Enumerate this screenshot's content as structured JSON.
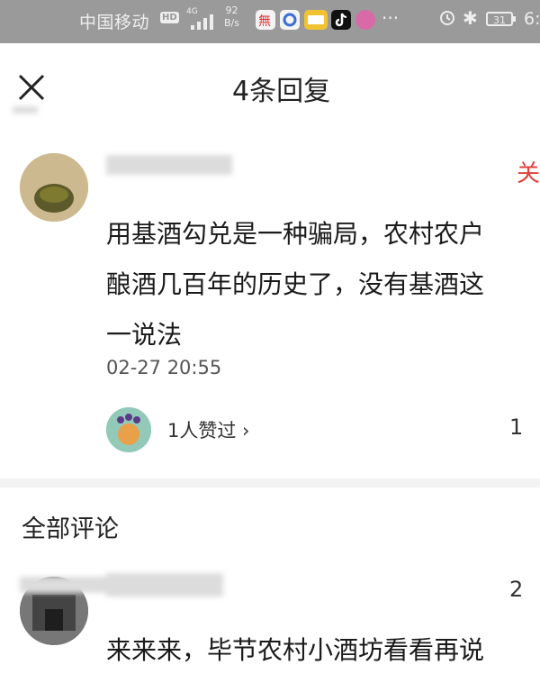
{
  "status_bar": {
    "carrier": "中国移动",
    "hd_badge": "HD",
    "network": "4G",
    "speed_value": "92",
    "speed_unit": "B/s",
    "app_icons": [
      "weibo-icon",
      "search-app-icon",
      "reading-app-icon",
      "tiktok-icon",
      "browser-icon"
    ],
    "more": "···",
    "battery": "31",
    "time": "6:"
  },
  "header": {
    "title": "4条回复"
  },
  "main_comment": {
    "text": "用基酒勾兑是一种骗局，农村农户\n酿酒几百年的历史了，没有基酒这\n一说法",
    "timestamp": "02-27 20:55",
    "follow_label": "关",
    "likers_label": "1人赞过 ›",
    "like_count": "1"
  },
  "section": {
    "title": "全部评论"
  },
  "comments": [
    {
      "text": "来来来，毕节农村小酒坊看看再说",
      "like_count": "2"
    }
  ],
  "colors": {
    "status_bar_bg": "#9a9a9a",
    "follow_red": "#e0413a",
    "separator": "#f3f3f3"
  }
}
